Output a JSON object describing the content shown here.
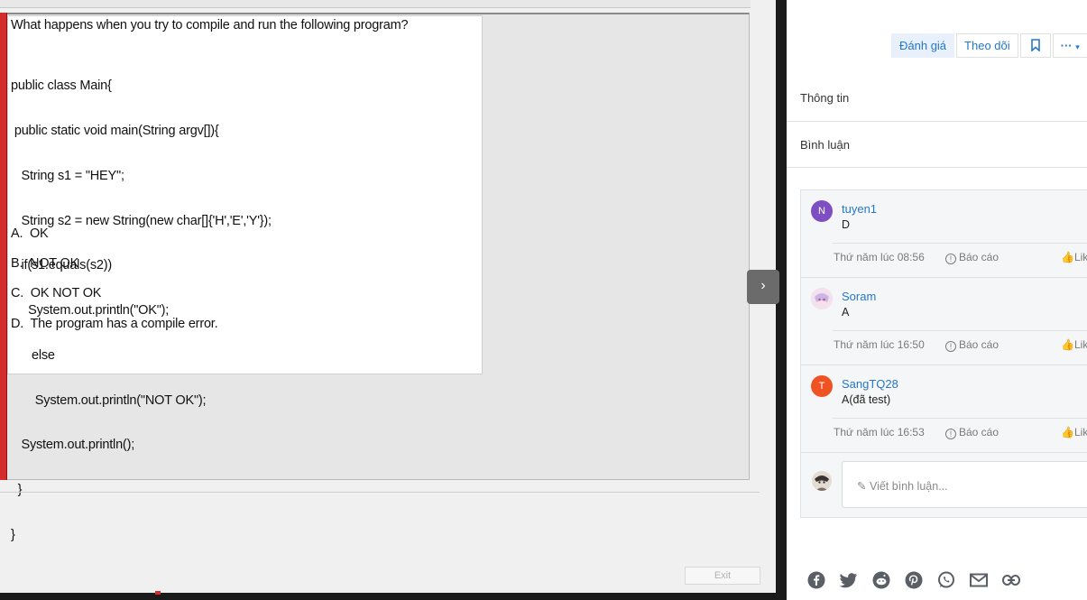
{
  "exam": {
    "question": "What happens when you try to compile and run the following program?",
    "code_lines": [
      "public class Main{",
      " public static void main(String argv[]){",
      "   String s1 = \"HEY\";",
      "   String s2 = new String(new char[]{'H','E','Y'});",
      "   if(s1.equals(s2))",
      "     System.out.println(\"OK\");",
      "      else",
      "       System.out.println(\"NOT OK\");",
      "   System.out.println();",
      "  }",
      "}"
    ],
    "options": [
      "A.  OK",
      "B.  NOT OK",
      "C.  OK NOT OK",
      "D.  The program has a compile error."
    ],
    "exit_label": "Exit"
  },
  "actions": {
    "rate_label": "Đánh giá",
    "follow_label": "Theo dõi",
    "bookmark_icon": "bookmark-icon",
    "more_label": "···"
  },
  "tabs": {
    "info_label": "Thông tin",
    "comments_label": "Bình luận"
  },
  "comments": [
    {
      "avatar_letter": "N",
      "avatar_color": "#7d4fc2",
      "author": "tuyen1",
      "text": "D",
      "time": "Thứ năm lúc 08:56",
      "report": "Báo cáo",
      "like": "Lik"
    },
    {
      "avatar_letter": "",
      "avatar_color": "#f1d9e6",
      "author": "Soram",
      "text": "A",
      "time": "Thứ năm lúc 16:50",
      "report": "Báo cáo",
      "like": "Lik"
    },
    {
      "avatar_letter": "T",
      "avatar_color": "#f05323",
      "author": "SangTQ28",
      "text": "A(đã test)",
      "time": "Thứ năm lúc 16:53",
      "report": "Báo cáo",
      "like": "Lik"
    }
  ],
  "compose": {
    "placeholder": "Viết bình luận..."
  },
  "share_icons": [
    "facebook-icon",
    "twitter-icon",
    "reddit-icon",
    "pinterest-icon",
    "whatsapp-icon",
    "email-icon",
    "link-icon"
  ],
  "colors": {
    "accent": "#2577c9",
    "red_bar": "#d42b2b"
  }
}
